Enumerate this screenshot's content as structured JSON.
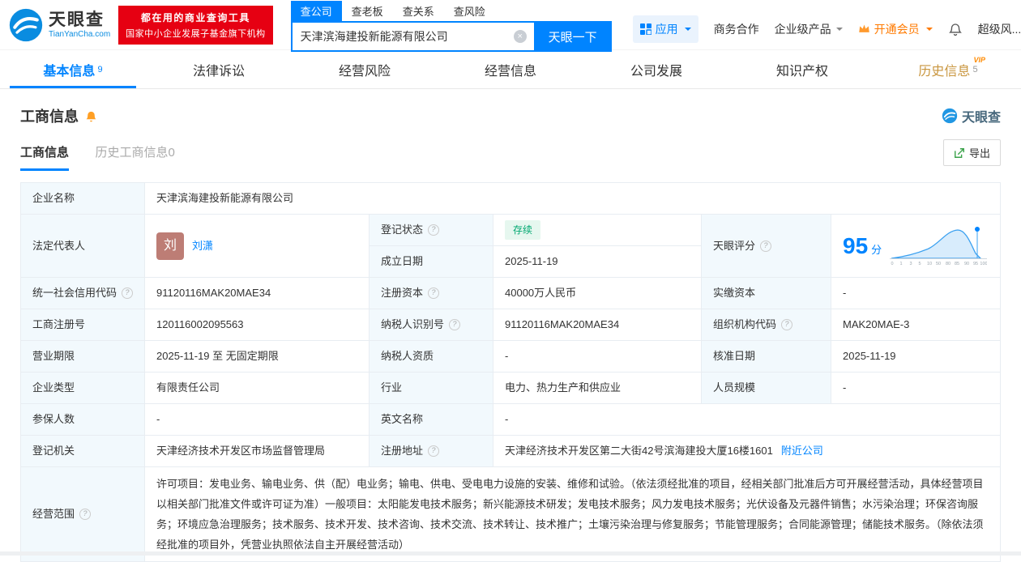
{
  "header": {
    "logo": {
      "name": "天眼查",
      "domain": "TianYanCha.com"
    },
    "promo": {
      "line1": "都在用的商业查询工具",
      "line2": "国家中小企业发展子基金旗下机构"
    },
    "search": {
      "tabs": [
        "查公司",
        "查老板",
        "查关系",
        "查风险"
      ],
      "value": "天津滨海建投新能源有限公司",
      "button": "天眼一下"
    },
    "menu": {
      "apps": "应用",
      "cooperation": "商务合作",
      "enterprise": "企业级产品",
      "membership": "开通会员",
      "super": "超级风..."
    }
  },
  "nav": {
    "items": [
      {
        "label": "基本信息",
        "count": "9"
      },
      {
        "label": "法律诉讼"
      },
      {
        "label": "经营风险"
      },
      {
        "label": "经营信息"
      },
      {
        "label": "公司发展"
      },
      {
        "label": "知识产权"
      },
      {
        "label": "历史信息",
        "count": "5",
        "tag": "VIP"
      }
    ]
  },
  "section": {
    "title": "工商信息",
    "watermark": "天眼查",
    "tabs": {
      "current": "工商信息",
      "history": "历史工商信息0"
    },
    "export": "导出"
  },
  "table": {
    "company_name": {
      "label": "企业名称",
      "value": "天津滨海建投新能源有限公司"
    },
    "legal_rep": {
      "label": "法定代表人",
      "avatar": "刘",
      "name": "刘潇"
    },
    "reg_status": {
      "label": "登记状态",
      "value": "存续"
    },
    "establish_date": {
      "label": "成立日期",
      "value": "2025-11-19"
    },
    "score": {
      "label": "天眼评分",
      "value": "95",
      "unit": "分",
      "ticks": [
        "0",
        "1",
        "3",
        "5",
        "10",
        "50",
        "80",
        "85",
        "90",
        "95",
        "100"
      ]
    },
    "credit_code": {
      "label": "统一社会信用代码",
      "value": "91120116MAK20MAE34"
    },
    "reg_capital": {
      "label": "注册资本",
      "value": "40000万人民币"
    },
    "paid_capital": {
      "label": "实缴资本",
      "value": "-"
    },
    "reg_number": {
      "label": "工商注册号",
      "value": "120116002095563"
    },
    "taxpayer_id": {
      "label": "纳税人识别号",
      "value": "91120116MAK20MAE34"
    },
    "org_code": {
      "label": "组织机构代码",
      "value": "MAK20MAE-3"
    },
    "business_term": {
      "label": "营业期限",
      "value": "2025-11-19 至 无固定期限"
    },
    "taxpayer_quality": {
      "label": "纳税人资质",
      "value": "-"
    },
    "approval_date": {
      "label": "核准日期",
      "value": "2025-11-19"
    },
    "company_type": {
      "label": "企业类型",
      "value": "有限责任公司"
    },
    "industry": {
      "label": "行业",
      "value": "电力、热力生产和供应业"
    },
    "staff_size": {
      "label": "人员规模",
      "value": "-"
    },
    "insured_count": {
      "label": "参保人数",
      "value": "-"
    },
    "english_name": {
      "label": "英文名称",
      "value": "-"
    },
    "reg_authority": {
      "label": "登记机关",
      "value": "天津经济技术开发区市场监督管理局"
    },
    "reg_address": {
      "label": "注册地址",
      "value": "天津经济技术开发区第二大街42号滨海建投大厦16楼1601",
      "link": "附近公司"
    },
    "business_scope": {
      "label": "经营范围",
      "value": "许可项目：发电业务、输电业务、供（配）电业务；输电、供电、受电电力设施的安装、维修和试验。（依法须经批准的项目，经相关部门批准后方可开展经营活动，具体经营项目以相关部门批准文件或许可证为准）一般项目：太阳能发电技术服务；新兴能源技术研发；发电技术服务；风力发电技术服务；光伏设备及元器件销售；水污染治理；环保咨询服务；环境应急治理服务；技术服务、技术开发、技术咨询、技术交流、技术转让、技术推广；土壤污染治理与修复服务；节能管理服务；合同能源管理；储能技术服务。（除依法须经批准的项目外，凭营业执照依法自主开展经营活动）"
    }
  },
  "icons": {
    "help": "?",
    "clear": "×"
  },
  "colors": {
    "brand_blue": "#0084ff",
    "promo_red": "#e60012",
    "vip_orange": "#ff7a00",
    "status_green": "#00a870",
    "history_gold": "#c9963f",
    "label_bg": "#f2f9fd"
  }
}
